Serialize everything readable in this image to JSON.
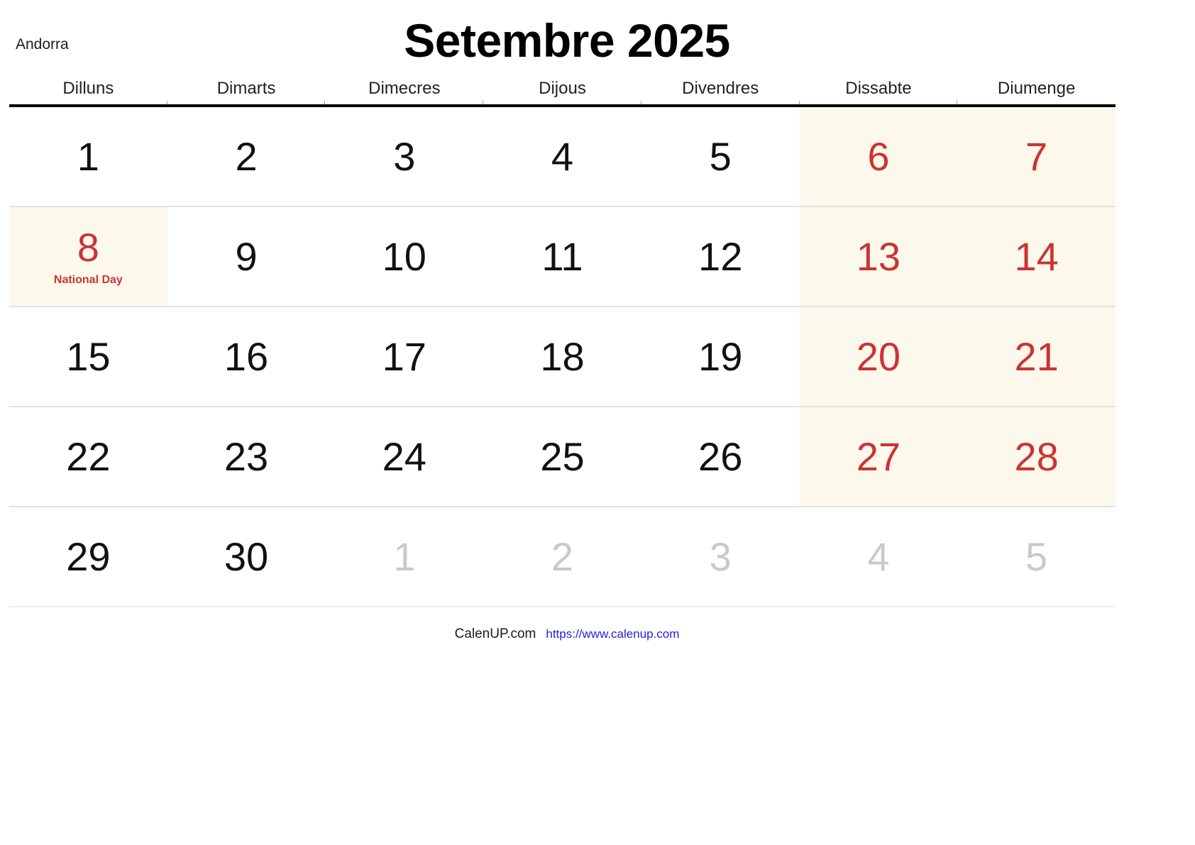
{
  "header": {
    "country": "Andorra",
    "title": "Setembre 2025"
  },
  "weekdays": [
    {
      "label": "Dilluns"
    },
    {
      "label": "Dimarts"
    },
    {
      "label": "Dimecres"
    },
    {
      "label": "Dijous"
    },
    {
      "label": "Divendres"
    },
    {
      "label": "Dissabte"
    },
    {
      "label": "Diumenge"
    }
  ],
  "colors": {
    "weekend_text": "#cc3333",
    "holiday_text": "#cc3333",
    "other_month_text": "#c9c9c9",
    "shade_background": "#fdf8ec",
    "header_rule": "#000000",
    "row_rule": "#e2e2e2",
    "link": "#2222dd"
  },
  "weeks": [
    {
      "days": [
        {
          "num": "1",
          "kind": "normal",
          "shaded": false,
          "event": ""
        },
        {
          "num": "2",
          "kind": "normal",
          "shaded": false,
          "event": ""
        },
        {
          "num": "3",
          "kind": "normal",
          "shaded": false,
          "event": ""
        },
        {
          "num": "4",
          "kind": "normal",
          "shaded": false,
          "event": ""
        },
        {
          "num": "5",
          "kind": "normal",
          "shaded": false,
          "event": ""
        },
        {
          "num": "6",
          "kind": "weekend",
          "shaded": true,
          "event": ""
        },
        {
          "num": "7",
          "kind": "weekend",
          "shaded": true,
          "event": ""
        }
      ]
    },
    {
      "days": [
        {
          "num": "8",
          "kind": "holiday",
          "shaded": true,
          "event": "National Day"
        },
        {
          "num": "9",
          "kind": "normal",
          "shaded": false,
          "event": ""
        },
        {
          "num": "10",
          "kind": "normal",
          "shaded": false,
          "event": ""
        },
        {
          "num": "11",
          "kind": "normal",
          "shaded": false,
          "event": ""
        },
        {
          "num": "12",
          "kind": "normal",
          "shaded": false,
          "event": ""
        },
        {
          "num": "13",
          "kind": "weekend",
          "shaded": true,
          "event": ""
        },
        {
          "num": "14",
          "kind": "weekend",
          "shaded": true,
          "event": ""
        }
      ]
    },
    {
      "days": [
        {
          "num": "15",
          "kind": "normal",
          "shaded": false,
          "event": ""
        },
        {
          "num": "16",
          "kind": "normal",
          "shaded": false,
          "event": ""
        },
        {
          "num": "17",
          "kind": "normal",
          "shaded": false,
          "event": ""
        },
        {
          "num": "18",
          "kind": "normal",
          "shaded": false,
          "event": ""
        },
        {
          "num": "19",
          "kind": "normal",
          "shaded": false,
          "event": ""
        },
        {
          "num": "20",
          "kind": "weekend",
          "shaded": true,
          "event": ""
        },
        {
          "num": "21",
          "kind": "weekend",
          "shaded": true,
          "event": ""
        }
      ]
    },
    {
      "days": [
        {
          "num": "22",
          "kind": "normal",
          "shaded": false,
          "event": ""
        },
        {
          "num": "23",
          "kind": "normal",
          "shaded": false,
          "event": ""
        },
        {
          "num": "24",
          "kind": "normal",
          "shaded": false,
          "event": ""
        },
        {
          "num": "25",
          "kind": "normal",
          "shaded": false,
          "event": ""
        },
        {
          "num": "26",
          "kind": "normal",
          "shaded": false,
          "event": ""
        },
        {
          "num": "27",
          "kind": "weekend",
          "shaded": true,
          "event": ""
        },
        {
          "num": "28",
          "kind": "weekend",
          "shaded": true,
          "event": ""
        }
      ]
    },
    {
      "days": [
        {
          "num": "29",
          "kind": "normal",
          "shaded": false,
          "event": ""
        },
        {
          "num": "30",
          "kind": "normal",
          "shaded": false,
          "event": ""
        },
        {
          "num": "1",
          "kind": "other-month",
          "shaded": false,
          "event": ""
        },
        {
          "num": "2",
          "kind": "other-month",
          "shaded": false,
          "event": ""
        },
        {
          "num": "3",
          "kind": "other-month",
          "shaded": false,
          "event": ""
        },
        {
          "num": "4",
          "kind": "other-month",
          "shaded": false,
          "event": ""
        },
        {
          "num": "5",
          "kind": "other-month",
          "shaded": false,
          "event": ""
        }
      ]
    }
  ],
  "footer": {
    "brand": "CalenUP.com",
    "url": "https://www.calenup.com"
  }
}
